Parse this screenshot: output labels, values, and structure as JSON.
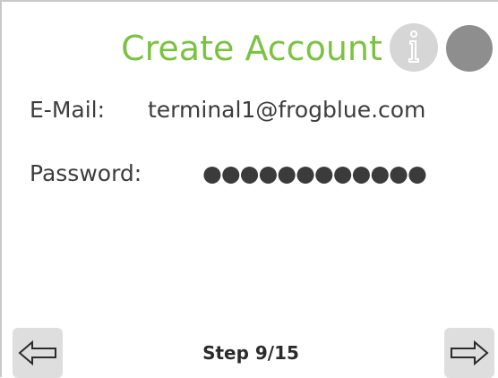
{
  "header": {
    "title": "Create Account",
    "info_icon": "info-icon",
    "status_indicator_color": "#8e8e8e"
  },
  "form": {
    "email_label": "E-Mail:",
    "email_value": "terminal1@frogblue.com",
    "password_label": "Password:",
    "password_value": "●●●●●●●●●●●●"
  },
  "footer": {
    "prev_icon": "arrow-left-icon",
    "next_icon": "arrow-right-icon",
    "step_text": "Step 9/15"
  },
  "colors": {
    "accent": "#7cc242",
    "text": "#3d3d3d",
    "button_bg": "#dedede"
  }
}
